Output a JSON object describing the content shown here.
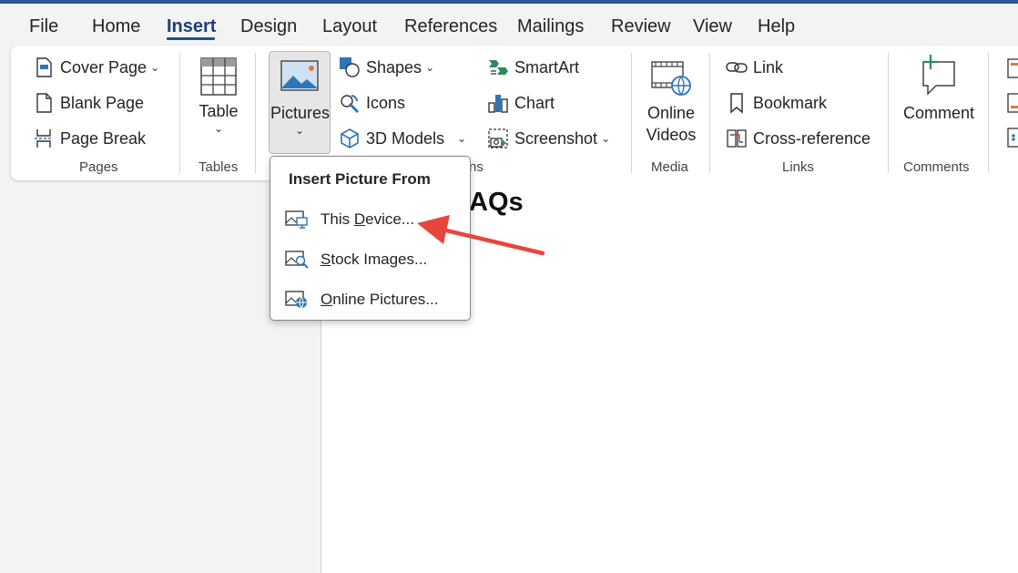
{
  "tabs": [
    {
      "label": "File"
    },
    {
      "label": "Home"
    },
    {
      "label": "Insert",
      "active": true
    },
    {
      "label": "Design"
    },
    {
      "label": "Layout"
    },
    {
      "label": "References"
    },
    {
      "label": "Mailings"
    },
    {
      "label": "Review"
    },
    {
      "label": "View"
    },
    {
      "label": "Help"
    }
  ],
  "ribbon": {
    "pages": {
      "label": "Pages",
      "cover_page": "Cover Page",
      "blank_page": "Blank Page",
      "page_break": "Page Break"
    },
    "tables": {
      "label": "Tables",
      "table": "Table"
    },
    "illustrations": {
      "label_visible_fragment": "ns",
      "pictures": "Pictures",
      "shapes": "Shapes",
      "icons": "Icons",
      "models_3d": "3D Models",
      "smartart": "SmartArt",
      "chart": "Chart",
      "screenshot": "Screenshot"
    },
    "media": {
      "label": "Media",
      "online_videos_line1": "Online",
      "online_videos_line2": "Videos"
    },
    "links": {
      "label": "Links",
      "link": "Link",
      "bookmark": "Bookmark",
      "cross_reference": "Cross-reference"
    },
    "comments": {
      "label": "Comments",
      "comment": "Comment"
    }
  },
  "document": {
    "heading_fragment": "AQs"
  },
  "insert_picture_menu": {
    "title": "Insert Picture From",
    "items": [
      {
        "label_pre": "This ",
        "label_access": "D",
        "label_post": "evice...",
        "icon": "device-picture-icon"
      },
      {
        "label_pre": "",
        "label_access": "S",
        "label_post": "tock Images...",
        "icon": "stock-images-icon"
      },
      {
        "label_pre": "",
        "label_access": "O",
        "label_post": "nline Pictures...",
        "icon": "online-pictures-icon"
      }
    ]
  },
  "colors": {
    "accent_blue": "#1f4f8f",
    "icon_blue": "#2e75b6",
    "annotation_arrow": "#e8453c"
  }
}
